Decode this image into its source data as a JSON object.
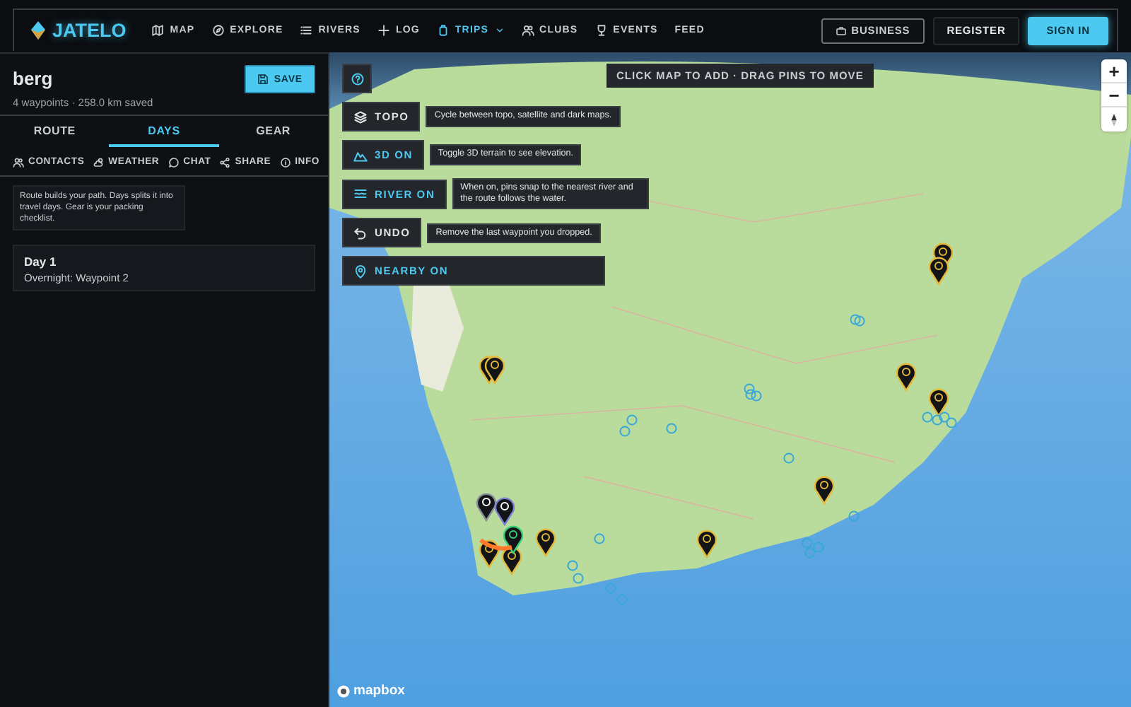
{
  "nav": {
    "brand": "JATELO",
    "links": [
      {
        "kind": "map",
        "label": "MAP",
        "selected": false,
        "dropdown": false
      },
      {
        "kind": "explore",
        "label": "EXPLORE",
        "selected": false,
        "dropdown": false
      },
      {
        "kind": "list",
        "label": "RIVERS",
        "selected": false,
        "dropdown": false
      },
      {
        "kind": "plus",
        "label": "LOG",
        "selected": false,
        "dropdown": false
      },
      {
        "kind": "bag",
        "label": "TRIPS",
        "selected": true,
        "dropdown": true
      },
      {
        "kind": "people",
        "label": "CLUBS",
        "selected": false,
        "dropdown": false
      },
      {
        "kind": "trophy",
        "label": "EVENTS",
        "selected": false,
        "dropdown": false
      },
      {
        "kind": "none",
        "label": "FEED",
        "selected": false,
        "dropdown": false
      }
    ],
    "buttons": [
      {
        "kind": "outline",
        "label": "BUSINESS"
      },
      {
        "kind": "dark",
        "label": "REGISTER"
      },
      {
        "kind": "primary",
        "label": "SIGN IN"
      }
    ]
  },
  "trip": {
    "name": "berg",
    "summary": "4 waypoints · 258.0 km saved",
    "save": "SAVE"
  },
  "tabs": [
    {
      "label": "ROUTE",
      "selected": false
    },
    {
      "label": "DAYS",
      "selected": true
    },
    {
      "label": "GEAR",
      "selected": false
    }
  ],
  "subtabs": [
    {
      "kind": "people",
      "label": "CONTACTS"
    },
    {
      "kind": "weather",
      "label": "WEATHER"
    },
    {
      "kind": "chat",
      "label": "CHAT"
    },
    {
      "kind": "share",
      "label": "SHARE"
    },
    {
      "kind": "info",
      "label": "INFO"
    }
  ],
  "hint": "Route builds your path. Days splits it into travel days. Gear is your packing checklist.",
  "days": [
    {
      "title": "Day 1",
      "detail": "Overnight: Waypoint 2"
    }
  ],
  "map": {
    "banner": "CLICK MAP TO ADD · DRAG PINS TO MOVE",
    "controls": [
      {
        "kind": "help"
      },
      {
        "kind": "layers",
        "label": "TOPO",
        "on": false,
        "tooltip": "Cycle between topo, satellite and dark maps."
      },
      {
        "kind": "terrain",
        "label": "3D ON",
        "on": true,
        "tooltip": "Toggle 3D terrain to see elevation."
      },
      {
        "kind": "river",
        "label": "RIVER ON",
        "on": true,
        "tooltip": "When on, pins snap to the nearest river and the route follows the water."
      },
      {
        "kind": "undo",
        "label": "UNDO",
        "on": false,
        "tooltip": "Remove the last waypoint you dropped."
      },
      {
        "kind": "nearby",
        "label": "NEARBY ON",
        "on": true
      }
    ],
    "zoom": [
      "+",
      "−"
    ],
    "attribution": "mapbox"
  }
}
